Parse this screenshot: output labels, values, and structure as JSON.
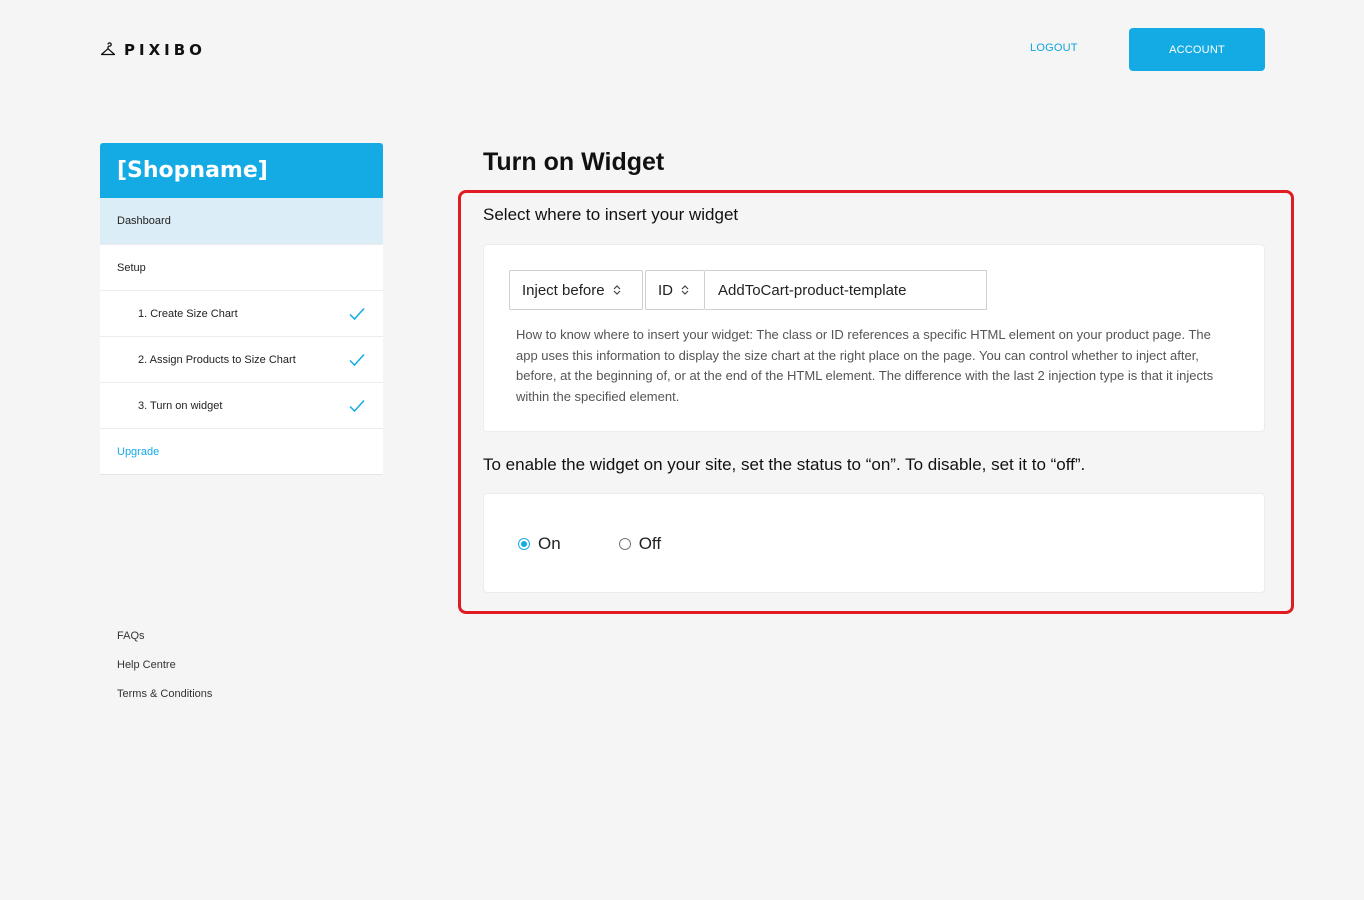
{
  "brand": {
    "name": "PIXIBO",
    "icon": "hanger-icon"
  },
  "header": {
    "logout_label": "LOGOUT",
    "account_label": "ACCOUNT"
  },
  "sidebar": {
    "shop_name": "[Shopname]",
    "items": [
      {
        "label": "Dashboard"
      },
      {
        "label": "Setup"
      },
      {
        "label": "1. Create Size Chart",
        "done": true
      },
      {
        "label": "2. Assign Products to Size Chart",
        "done": true
      },
      {
        "label": "3. Turn on widget",
        "done": true
      },
      {
        "label": "Upgrade"
      }
    ]
  },
  "footer": {
    "links": [
      "FAQs",
      "Help Centre",
      "Terms & Conditions"
    ]
  },
  "main": {
    "title": "Turn on Widget",
    "insert_section": {
      "label": "Select where to insert your widget",
      "position_select": "Inject before",
      "selector_type": "ID",
      "selector_value": "AddToCart-product-template",
      "help": "How to know where to insert your widget: The class or ID references a specific HTML element on your product page. The app uses this information to display the size chart at the right place on the page. You can control whether to inject after, before, at the beginning of, or at the end of the HTML element. The difference with the last 2 injection type is that it injects within the specified element."
    },
    "status_section": {
      "label": "To enable the widget on your site, set the status to “on”. To disable, set it to “off”.",
      "options": [
        "On",
        "Off"
      ],
      "selected": "On"
    }
  },
  "colors": {
    "accent": "#14abe5",
    "active_nav": "#dbedf6",
    "highlight": "#e01b24"
  }
}
